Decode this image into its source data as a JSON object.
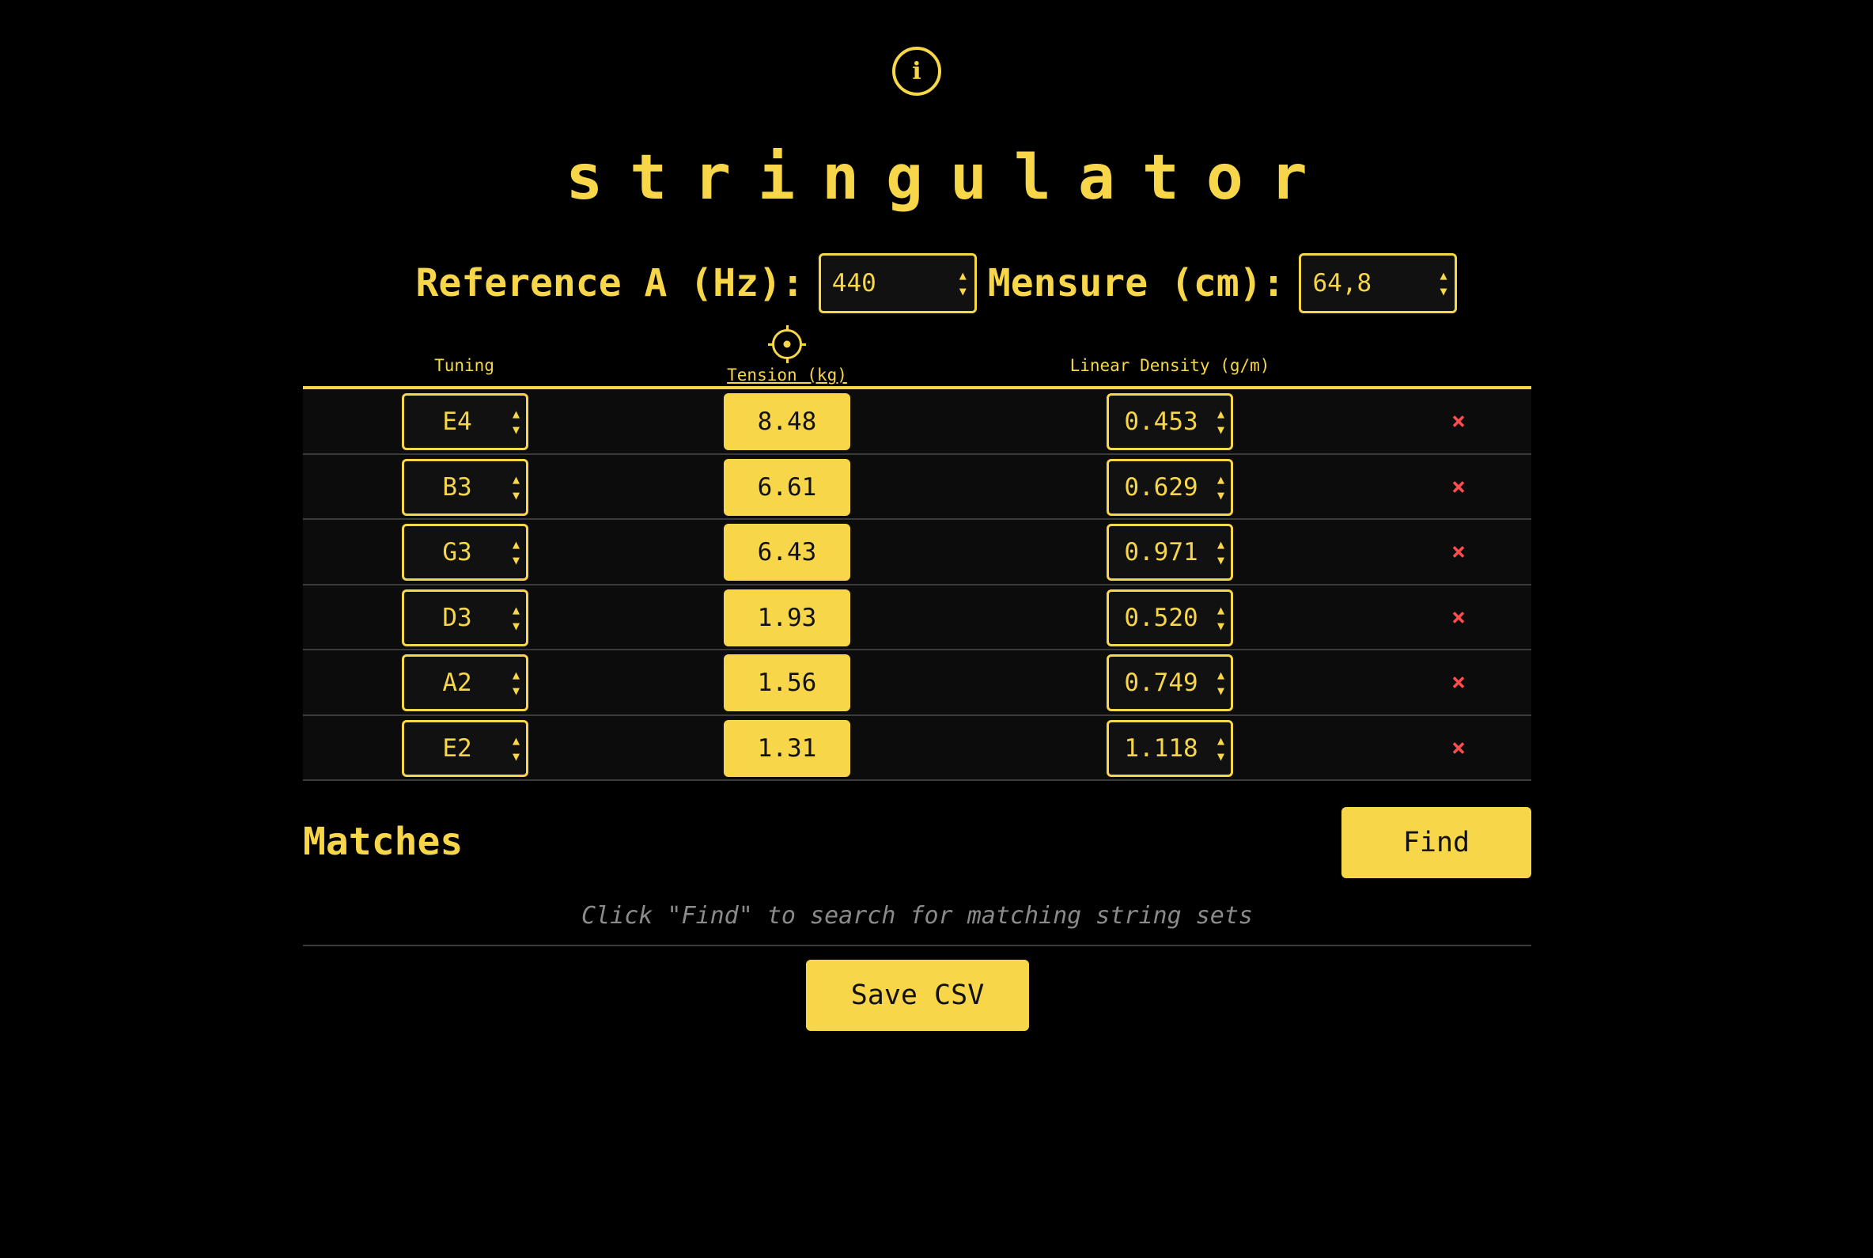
{
  "app": {
    "info_label": "i",
    "title": "stringulator"
  },
  "settings": {
    "reference_label": "Reference A (Hz):",
    "reference_value": "440",
    "mensure_label": "Mensure (cm):",
    "mensure_value": "64,8"
  },
  "table": {
    "headers": {
      "tuning": "Tuning",
      "tension": "Tension (kg)",
      "density": "Linear Density (g/m)"
    },
    "rows": [
      {
        "tuning": "E4",
        "tension": "8.48",
        "density": "0.453"
      },
      {
        "tuning": "B3",
        "tension": "6.61",
        "density": "0.629"
      },
      {
        "tuning": "G3",
        "tension": "6.43",
        "density": "0.971"
      },
      {
        "tuning": "D3",
        "tension": "1.93",
        "density": "0.520"
      },
      {
        "tuning": "A2",
        "tension": "1.56",
        "density": "0.749"
      },
      {
        "tuning": "E2",
        "tension": "1.31",
        "density": "1.118"
      }
    ],
    "remove_symbol": "×",
    "spin_up": "▲",
    "spin_down": "▼"
  },
  "matches": {
    "title": "Matches",
    "find_label": "Find",
    "hint": "Click \"Find\" to search for matching string sets"
  },
  "actions": {
    "save_label": "Save CSV"
  },
  "colors": {
    "accent": "#f7d64a",
    "background": "#000000",
    "remove": "#ff4d4d"
  }
}
